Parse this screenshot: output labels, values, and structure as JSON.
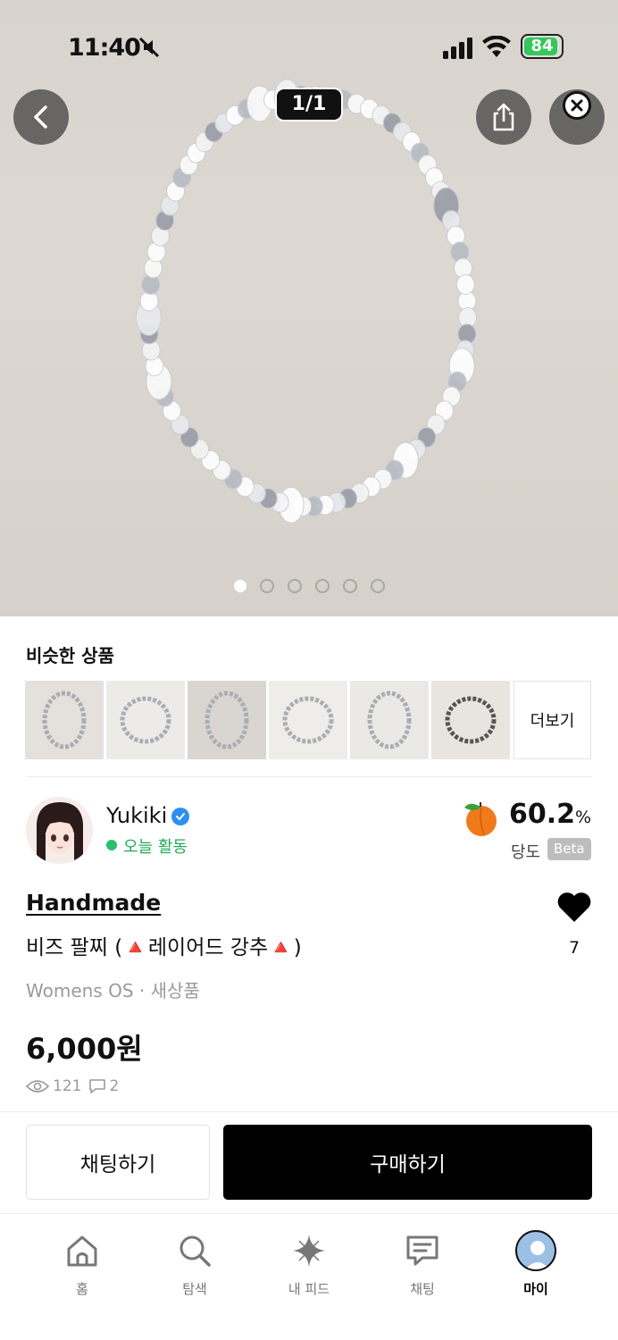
{
  "status_bar": {
    "time": "11:40",
    "battery": "84"
  },
  "gallery": {
    "page_indicator": "1/1",
    "dot_count": 6,
    "active_dot": 0
  },
  "similar": {
    "title": "비슷한 상품",
    "more_label": "더보기",
    "thumb_count": 6
  },
  "seller": {
    "name": "Yukiki",
    "activity": "오늘 활동",
    "rating_value": "60.2",
    "rating_unit": "%",
    "rating_label": "당도",
    "beta": "Beta"
  },
  "product": {
    "brand": "Handmade",
    "title": "비즈 팔찌 (🔺레이어드 강추🔺)",
    "meta": "Womens OS · 새상품",
    "price": "6,000원",
    "views": "121",
    "comments": "2",
    "likes": "7"
  },
  "actions": {
    "chat": "채팅하기",
    "buy": "구매하기"
  },
  "nav": [
    {
      "label": "홈",
      "icon": "home-icon"
    },
    {
      "label": "탐색",
      "icon": "search-icon"
    },
    {
      "label": "내 피드",
      "icon": "sparkle-icon"
    },
    {
      "label": "채팅",
      "icon": "chat-icon"
    },
    {
      "label": "마이",
      "icon": "profile-avatar"
    }
  ],
  "colors": {
    "active_green": "#22aa5a",
    "verified_blue": "#2f8ff0",
    "buy_button": "#000000"
  }
}
